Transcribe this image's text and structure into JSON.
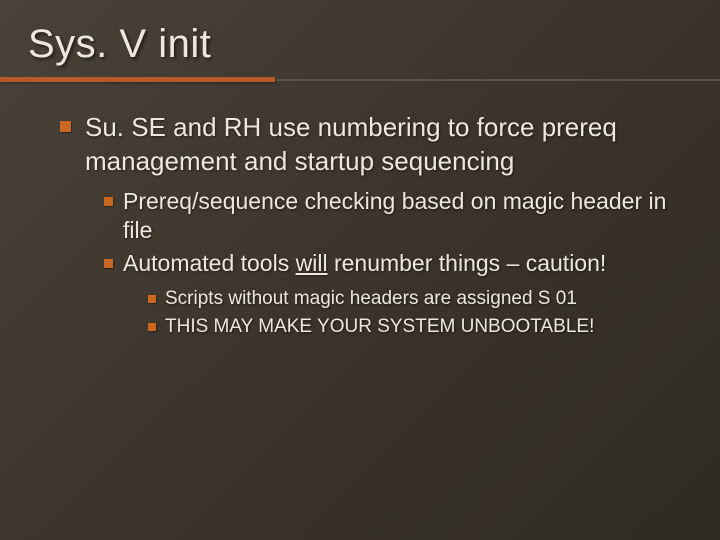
{
  "slide": {
    "title": "Sys. V init",
    "bullets": [
      {
        "text": "Su. SE and RH use numbering to force prereq management and startup sequencing",
        "children": [
          {
            "text": "Prereq/sequence checking based on magic header in file"
          },
          {
            "text_pre": "Automated tools ",
            "text_underlined": "will",
            "text_post": " renumber things – caution!",
            "children": [
              {
                "text": "Scripts without magic headers are assigned S 01"
              },
              {
                "text": "THIS MAY MAKE YOUR SYSTEM UNBOOTABLE!"
              }
            ]
          }
        ]
      }
    ]
  }
}
